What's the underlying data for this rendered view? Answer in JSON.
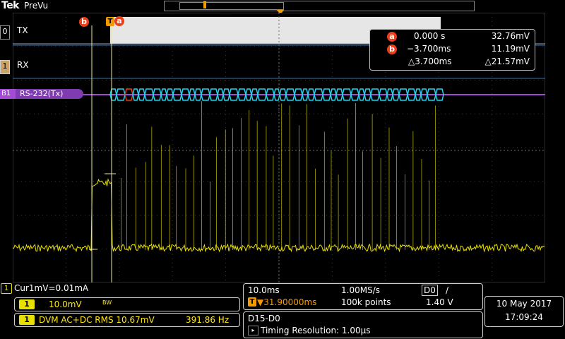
{
  "header": {
    "brand": "Tek",
    "mode": "PreVu"
  },
  "channels": {
    "digital": {
      "tab": "0",
      "label": "TX"
    },
    "ch1": {
      "tab": "1",
      "label": "RX"
    },
    "bus": {
      "tab": "B1",
      "label": "RS-232(Tx)"
    }
  },
  "cursors": {
    "a": {
      "badge": "a",
      "time": "0.000 s",
      "value": "32.76mV"
    },
    "b": {
      "badge": "b",
      "time": "−3.700ms",
      "value": "11.19mV"
    },
    "delta": {
      "time": "△3.700ms",
      "value": "△21.57mV"
    },
    "trigger_marker": "T"
  },
  "cursor_note": "Cur1mV=0.01mA",
  "ch1_scale": {
    "chip": "1",
    "value": "10.0mV",
    "bw": "BW"
  },
  "dvm": {
    "chip": "1",
    "text": "DVM AC+DC RMS 10.67mV",
    "freq": "391.86 Hz"
  },
  "acquisition": {
    "timebase": "10.0ms",
    "sample_rate": "1.00MS/s",
    "trigger_source": "D0",
    "trigger_slope": "/",
    "trigger_pos": "▼31.90000ms",
    "trigger_chip": "T",
    "record_length": "100k points",
    "trigger_level": "1.40 V"
  },
  "digital_info": {
    "title": "D15-D0",
    "resolution": "Timing Resolution: 1.00µs"
  },
  "datetime": {
    "date": "10 May 2017",
    "time": "17:09:24"
  },
  "colors": {
    "ch1": "#e8e000",
    "bus": "#a34bd6",
    "bus_data": "#22d6f0",
    "cursor": "#e8401a",
    "trigger": "#f39a00"
  }
}
